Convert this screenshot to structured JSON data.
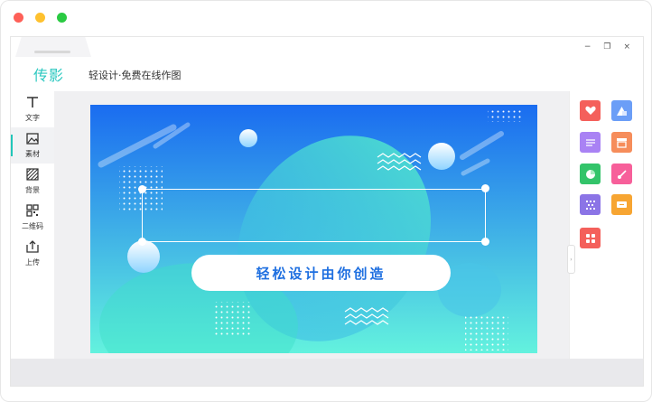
{
  "window": {
    "buttons": [
      {
        "name": "close",
        "color": "#fe6058"
      },
      {
        "name": "minimize",
        "color": "#fec12f"
      },
      {
        "name": "zoom",
        "color": "#2aca42"
      }
    ]
  },
  "controls": {
    "minimize": "−",
    "restore": "❐",
    "close": "×"
  },
  "header": {
    "logo": "传影",
    "slogan": "轻设计·免费在线作图"
  },
  "sidebar": {
    "items": [
      {
        "label": "文字",
        "icon": "text-icon"
      },
      {
        "label": "素材",
        "icon": "image-icon"
      },
      {
        "label": "背景",
        "icon": "background-icon"
      },
      {
        "label": "二维码",
        "icon": "qrcode-icon"
      },
      {
        "label": "上传",
        "icon": "upload-icon"
      }
    ]
  },
  "banner": {
    "text": "轻松设计由你创造",
    "colors": {
      "top": "#1a6cf0",
      "bottom": "#63f2de",
      "accent": "#ffffff"
    }
  },
  "rightPanel": {
    "tiles": [
      {
        "icon": "heart-icon",
        "color": "#f4605b"
      },
      {
        "icon": "shapes-icon",
        "color": "#6b9ef7"
      },
      {
        "icon": "lines-icon",
        "color": "#a982f4"
      },
      {
        "icon": "shop-icon",
        "color": "#f68d5b"
      },
      {
        "icon": "pie-chart-icon",
        "color": "#33c46a"
      },
      {
        "icon": "brush-icon",
        "color": "#f75f9a"
      },
      {
        "icon": "pattern-icon",
        "color": "#8b74e6"
      },
      {
        "icon": "ticket-icon",
        "color": "#f7a532"
      },
      {
        "icon": "grid-icon",
        "color": "#f4605b"
      }
    ]
  }
}
